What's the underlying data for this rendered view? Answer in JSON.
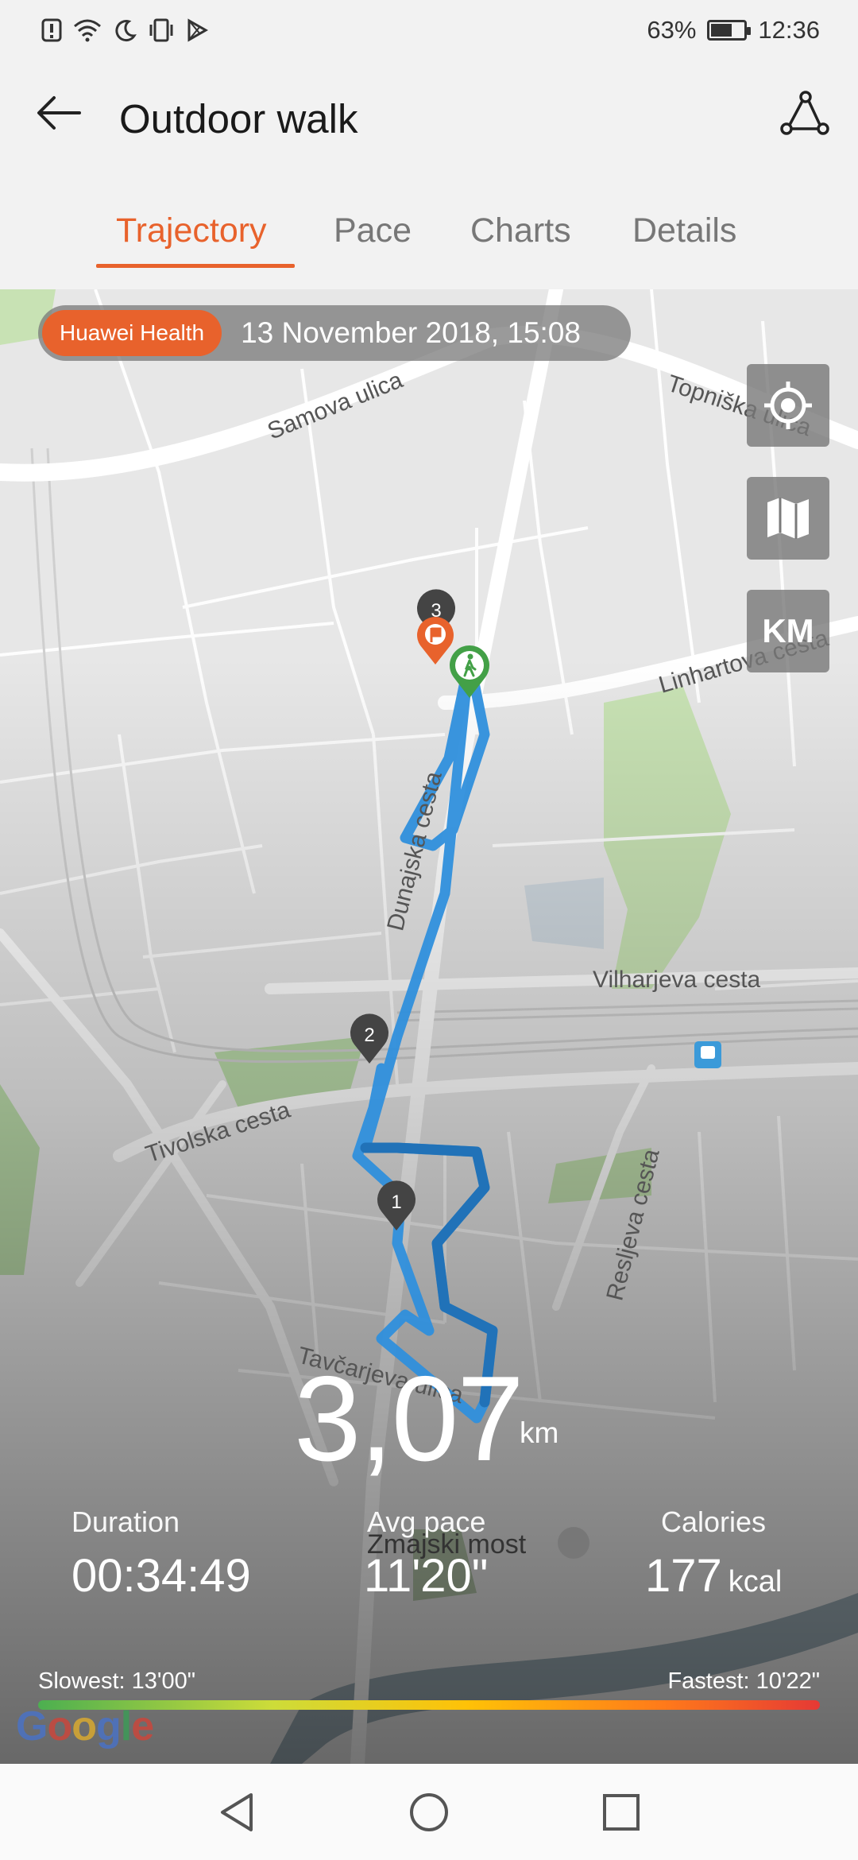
{
  "status_bar": {
    "battery_percent": "63%",
    "battery_level": 0.63,
    "time": "12:36",
    "icons": [
      "alert-icon",
      "wifi-icon",
      "moon-icon",
      "vibrate-icon",
      "play-store-icon"
    ]
  },
  "app_bar": {
    "title": "Outdoor walk",
    "back_icon": "arrow-left-icon",
    "route_icon": "route-icon"
  },
  "tabs": [
    {
      "label": "Trajectory",
      "active": true
    },
    {
      "label": "Pace",
      "active": false
    },
    {
      "label": "Charts",
      "active": false
    },
    {
      "label": "Details",
      "active": false
    }
  ],
  "map": {
    "badge": "Huawei Health",
    "date": "13 November 2018, 15:08",
    "km_button": "KM",
    "streets": [
      "Samova ulica",
      "Topniška ulica",
      "Linhartova cesta",
      "Dunajska cesta",
      "Vilharjeva cesta",
      "Tivolska cesta",
      "Resljeva cesta",
      "Tavčarjeva ulica",
      "Zmajski most"
    ],
    "markers": [
      "3",
      "2",
      "1"
    ],
    "attribution": "Google"
  },
  "summary": {
    "distance": "3,07",
    "distance_unit": "km",
    "duration_label": "Duration",
    "duration_value": "00:34:49",
    "pace_label": "Avg pace",
    "pace_value": "11'20\"",
    "calories_label": "Calories",
    "calories_value": "177",
    "calories_unit": "kcal",
    "slowest": "Slowest: 13'00\"",
    "fastest": "Fastest: 10'22\""
  },
  "colors": {
    "accent": "#e8622c",
    "route": "#2f8fdc",
    "start_marker": "#43a047"
  }
}
